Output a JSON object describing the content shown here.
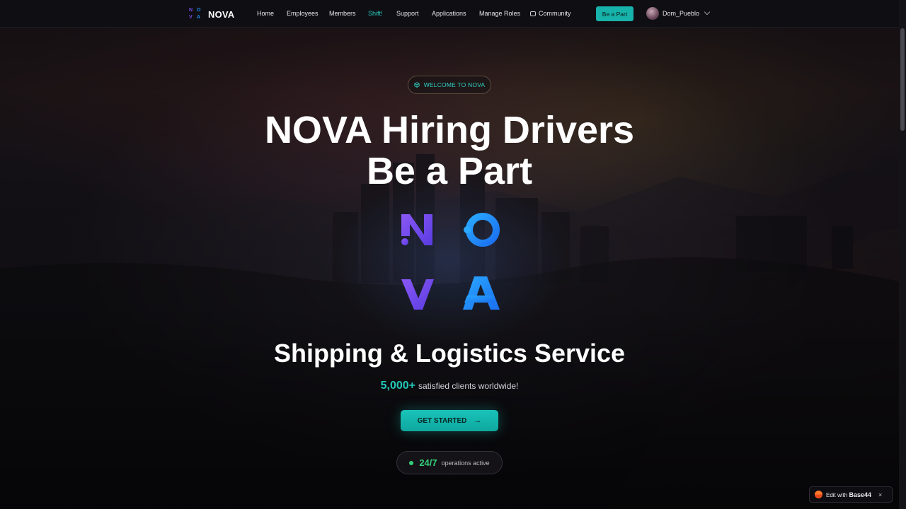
{
  "brand": {
    "name": "NOVA",
    "mark_letters": [
      "N",
      "O",
      "V",
      "A"
    ]
  },
  "nav": {
    "items": [
      {
        "label": "Home"
      },
      {
        "label": "Employees"
      },
      {
        "label": "Members"
      },
      {
        "label": "Shift!",
        "active": true
      },
      {
        "label": "Support"
      },
      {
        "label": "Applications"
      },
      {
        "label": "Manage Roles"
      },
      {
        "label": "Community",
        "icon": "chat-bubble-icon"
      }
    ],
    "cta_label": "Be a Part",
    "user": {
      "name": "Dom_Pueblo"
    }
  },
  "hero": {
    "badge": "WELCOME TO NOVA",
    "title_line1": "NOVA Hiring Drivers",
    "title_line2": "Be a Part",
    "logo_letters": [
      "N",
      "O",
      "V",
      "A"
    ],
    "subtitle": "Shipping & Logistics Service",
    "clients_count": "5,000+",
    "clients_text": "satisfied clients worldwide!",
    "cta_label": "GET STARTED",
    "ops_value": "24/7",
    "ops_text": "operations active"
  },
  "edit_badge": {
    "prefix": "Edit with",
    "brand": "Base44",
    "close": "×"
  },
  "colors": {
    "accent": "#17b3aa",
    "accent_text": "#28c7bd",
    "logo_purple": "#7b4ff0",
    "logo_blue": "#1d8ff0",
    "status_green": "#35d07a"
  }
}
